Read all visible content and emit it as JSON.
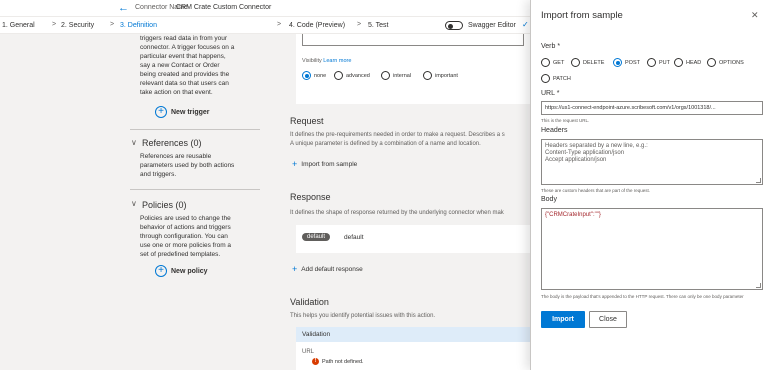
{
  "header": {
    "back_icon": "back-arrow-icon",
    "connector_label": "Connector Name",
    "connector_name": "CRM Crate Custom Connector"
  },
  "steps": [
    {
      "label": "1. General"
    },
    {
      "label": "2. Security"
    },
    {
      "label": "3. Definition"
    },
    {
      "label": "4. Code (Preview)"
    },
    {
      "label": "5. Test"
    }
  ],
  "swagger_label": "Swagger Editor",
  "left": {
    "trigger_text": [
      "triggers read data in from your",
      "connector. A trigger focuses on a",
      "particular event that happens,",
      "say a new Contact or Order",
      "being created and provides the",
      "relevant data so that users can",
      "take action on that event."
    ],
    "new_trigger": "New trigger",
    "references_heading": "References (0)",
    "references_text": [
      "References are reusable",
      "parameters used by both actions",
      "and triggers."
    ],
    "policies_heading": "Policies (0)",
    "policies_text": [
      "Policies are used to change the",
      "behavior of actions and triggers",
      "through configuration. You can",
      "use one or more policies from a",
      "set of predefined templates."
    ],
    "new_policy": "New policy"
  },
  "middle": {
    "visibility_label": "Visibility",
    "learn_more": "Learn more",
    "visibility_options": [
      {
        "label": "none",
        "selected": true
      },
      {
        "label": "advanced",
        "selected": false
      },
      {
        "label": "internal",
        "selected": false
      },
      {
        "label": "important",
        "selected": false
      }
    ],
    "request_title": "Request",
    "request_text_1": "It defines the pre-requirements needed in order to make a request. Describes a s",
    "request_text_2": "A unique parameter is defined by a combination of a name and location.",
    "import_from_sample": "Import from sample",
    "response_title": "Response",
    "response_text": "It defines the shape of response returned by the underlying connector when mak",
    "default_badge": "default",
    "default_label": "default",
    "add_default_response": "Add default response",
    "validation_title": "Validation",
    "validation_text": "This helps you identify potential issues with this action.",
    "validation_card_title": "Validation",
    "url_label": "URL",
    "path_error": "Path not defined."
  },
  "panel": {
    "title": "Import from sample",
    "verb_label": "Verb *",
    "verbs": [
      {
        "label": "GET",
        "selected": false
      },
      {
        "label": "DELETE",
        "selected": false
      },
      {
        "label": "POST",
        "selected": true
      },
      {
        "label": "PUT",
        "selected": false
      },
      {
        "label": "HEAD",
        "selected": false
      },
      {
        "label": "OPTIONS",
        "selected": false
      },
      {
        "label": "PATCH",
        "selected": false
      }
    ],
    "url_label": "URL *",
    "url_value": "https://us1-connect-endpoint-azure.scribesoft.com/v1/orgs/1001318/...",
    "url_hint": "This is the request URL.",
    "headers_label": "Headers",
    "headers_placeholder": "Headers separated by a new line, e.g.:\nContent-Type application/json\nAccept application/json",
    "headers_hint": "These are custom headers that are part of the request.",
    "body_label": "Body",
    "body_value": "{\"CRMCrateInput\":\"\"}",
    "body_hint": "The body is the payload that's appended to the HTTP request. There can only be one body parameter",
    "import_button": "Import",
    "close_button": "Close"
  }
}
